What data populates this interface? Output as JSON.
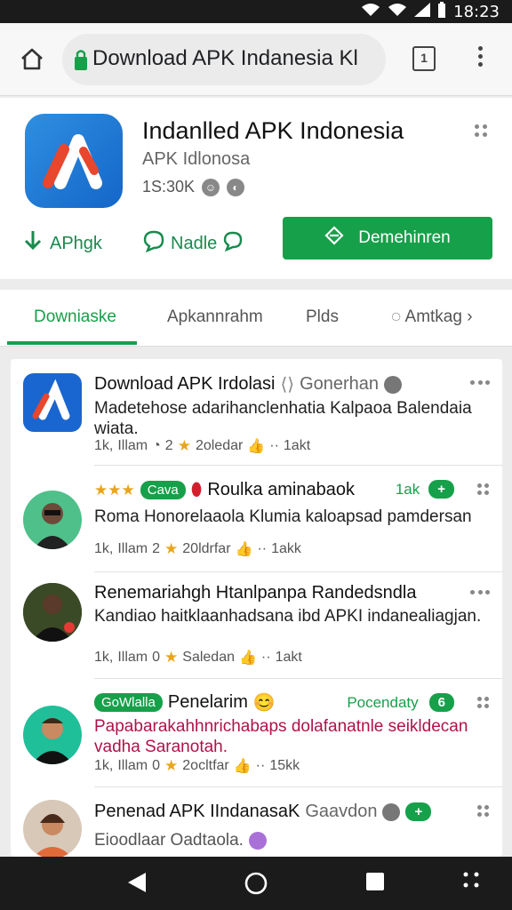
{
  "status": {
    "time": "18:23"
  },
  "browser": {
    "url": "Download APK Indanesia Kl",
    "tabs_count": "1"
  },
  "app": {
    "name": "Indanlled APK Indonesia",
    "subtitle": "APK Idlonosa",
    "downloads": "1S:30K",
    "actions": [
      {
        "label": "APhgk",
        "icon": "download-icon"
      },
      {
        "label": "Nadle",
        "icon": "chat-icon"
      }
    ],
    "primary_button": "Demehinren",
    "colors": {
      "accent": "#17a04a",
      "icon_bg": "#1c78d6"
    }
  },
  "tabs": [
    {
      "label": "Downiaske",
      "active": true
    },
    {
      "label": "Apkannrahm",
      "active": false
    },
    {
      "label": "Plds",
      "active": false
    },
    {
      "label": "Amtkag",
      "active": false
    }
  ],
  "items": [
    {
      "title": "Download APK Irdolasi",
      "source": "Gonerhan",
      "desc": "Madetehose adarihanclenhatia Kalpaoa Balendaia wiata.",
      "meta_count": "1k,",
      "meta_date": "Illam",
      "meta_num": "2",
      "meta_text": "2oledar",
      "meta_likes": "1akt"
    },
    {
      "badge": "Cava",
      "title": "Roulka aminabaok",
      "right_text": "1ak",
      "right_badge": "+",
      "desc": "Roma Honorelaaola Klumia kaloapsad pamdersan",
      "meta_count": "1k,",
      "meta_date": "Illam",
      "meta_num": "2",
      "meta_text": "20ldrfar",
      "meta_likes": "1akk"
    },
    {
      "title": "Renemariahgh Htanlpanpa Randedsndla",
      "desc": "Kandiao haitklaanhadsana ibd APKI indanealiagjan.",
      "meta_count": "1k,",
      "meta_date": "Illam",
      "meta_num": "0",
      "meta_text": "Saledan",
      "meta_likes": "1akt"
    },
    {
      "badge": "GoWlalla",
      "title": "Penelarim",
      "right_text": "Pocendaty",
      "right_badge": "6",
      "desc": "Papabarakahhnrichabaps dolafanatnle seikldecan vadha Saranotah.",
      "meta_count": "1k,",
      "meta_date": "Illam",
      "meta_num": "0",
      "meta_text": "2ocltfar",
      "meta_likes": "15kk"
    },
    {
      "title": "Penenad APK IIndanasaK",
      "source": "Gaavdon",
      "right_badge": "+",
      "desc": "Eioodlaar Oadtaola."
    }
  ]
}
